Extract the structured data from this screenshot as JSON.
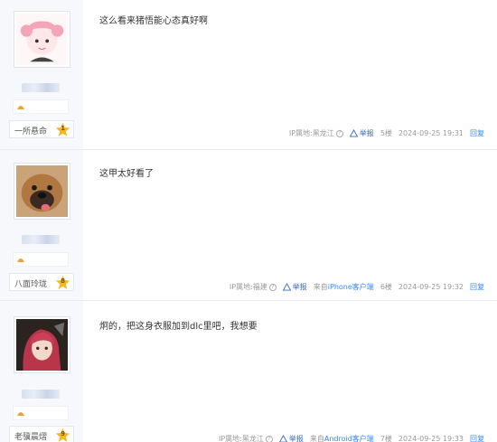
{
  "posts": [
    {
      "content": "这么看来猪悟能心态真好啊",
      "level_name": "一所悬命",
      "level_num": "1",
      "ip": "IP属地:黑龙江",
      "report": "举报",
      "client": "",
      "floor": "5楼",
      "time": "2024-09-25 19:31",
      "reply": "回复"
    },
    {
      "content": "这甲太好看了",
      "level_name": "八面玲珑",
      "level_num": "8",
      "ip": "IP属地:福建",
      "report": "举报",
      "client_prefix": "来自",
      "client": "iPhone客户端",
      "floor": "6楼",
      "time": "2024-09-25 19:32",
      "reply": "回复"
    },
    {
      "content": "炯的，把这身衣服加到dlc里吧，我想要",
      "level_name": "老骥晨熠",
      "level_num": "9",
      "ip": "IP属地:黑龙江",
      "report": "举报",
      "client_prefix": "来自",
      "client": "Android客户端",
      "floor": "7楼",
      "time": "2024-09-25 19:33",
      "reply": "回复"
    }
  ],
  "colors": {
    "link": "#3388ff",
    "sidebar": "#f6f8fc",
    "star": "#f5b820"
  }
}
